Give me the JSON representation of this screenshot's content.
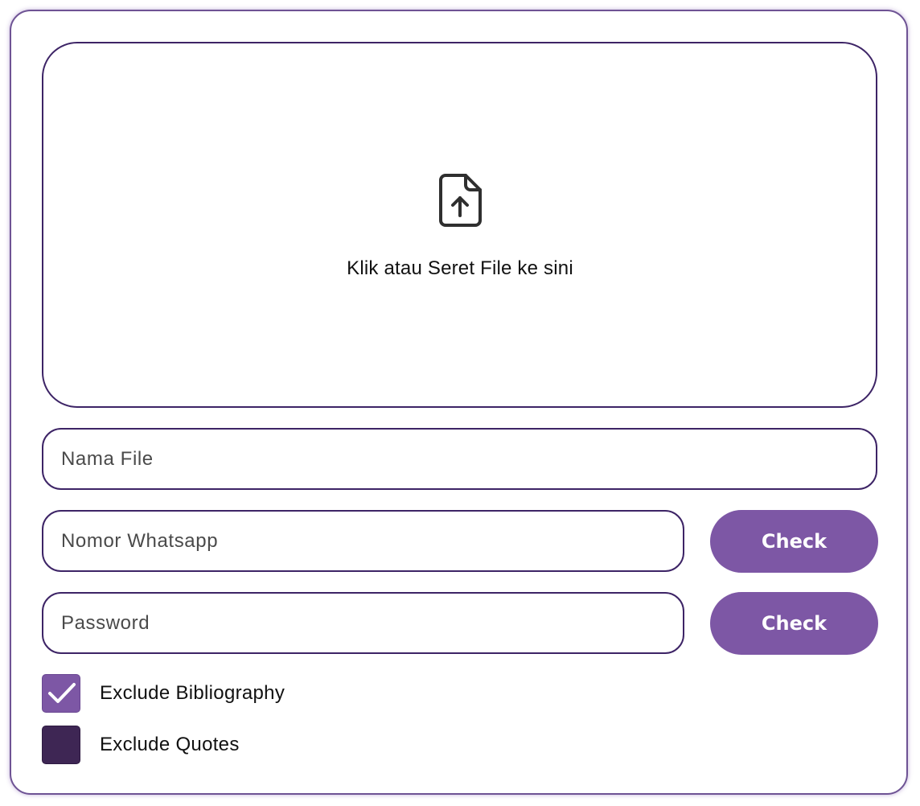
{
  "upload": {
    "icon": "file-upload-icon",
    "label": "Klik atau Seret File ke sini"
  },
  "fields": {
    "filename_placeholder": "Nama File",
    "filename_value": "",
    "phone_placeholder": "Nomor Whatsapp",
    "phone_value": "",
    "password_placeholder": "Password",
    "password_value": ""
  },
  "buttons": {
    "check_phone": "Check",
    "check_password": "Check"
  },
  "options": {
    "exclude_bibliography": {
      "label": "Exclude Bibliography",
      "checked": true
    },
    "exclude_quotes": {
      "label": "Exclude Quotes",
      "checked": false
    }
  },
  "colors": {
    "accent": "#7d57a5",
    "border": "#3d2466",
    "unchecked_box": "#3e2654"
  }
}
